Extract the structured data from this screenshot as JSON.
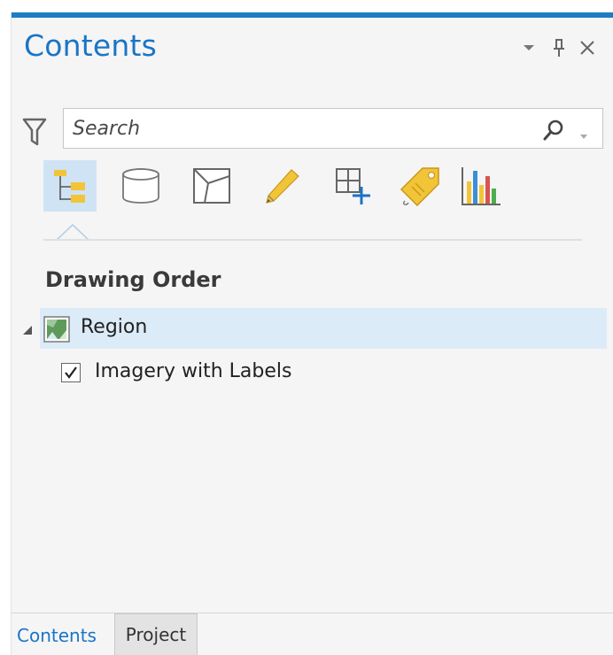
{
  "pane": {
    "title": "Contents",
    "controls": [
      {
        "name": "pane-menu",
        "icon": "chevron-down-icon"
      },
      {
        "name": "pin",
        "icon": "pin-icon"
      },
      {
        "name": "close",
        "icon": "close-icon"
      }
    ]
  },
  "search": {
    "placeholder": "Search",
    "value": "",
    "filter_icon": "filter-icon",
    "search_icon": "search-icon",
    "dropdown_icon": "chevron-down-icon"
  },
  "toolbar": {
    "buttons": [
      {
        "name": "list-by-drawing-order",
        "icon": "drawing-order-icon",
        "active": true
      },
      {
        "name": "list-by-data-source",
        "icon": "data-source-icon",
        "active": false
      },
      {
        "name": "list-by-selection",
        "icon": "selection-icon",
        "active": false
      },
      {
        "name": "list-by-editing",
        "icon": "pencil-icon",
        "active": false
      },
      {
        "name": "list-by-snapping",
        "icon": "snapping-icon",
        "active": false
      },
      {
        "name": "list-by-labeling",
        "icon": "label-tag-icon",
        "active": false
      },
      {
        "name": "list-by-charts",
        "icon": "bar-chart-icon",
        "active": false
      }
    ]
  },
  "tree": {
    "heading": "Drawing Order",
    "map": {
      "label": "Region",
      "expanded": true,
      "icon": "map-icon"
    },
    "layers": [
      {
        "label": "Imagery with Labels",
        "checked": true
      }
    ]
  },
  "tabs": [
    {
      "label": "Contents",
      "active": true
    },
    {
      "label": "Project",
      "active": false
    }
  ],
  "colors": {
    "accent": "#1e7cc3",
    "title_blue": "#1a74c6",
    "selected_row": "#dcebf8",
    "active_tool": "#cfe3f5",
    "pane_bg": "#f5f5f5"
  }
}
